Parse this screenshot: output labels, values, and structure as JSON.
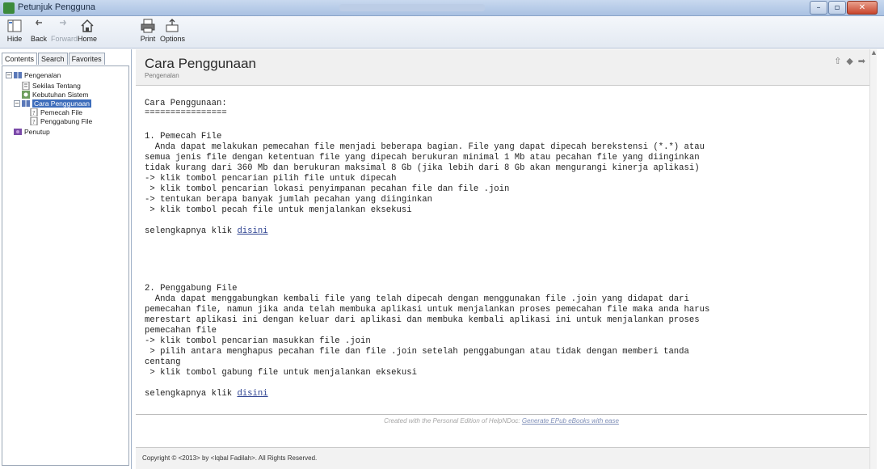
{
  "window": {
    "title": "Petunjuk Pengguna",
    "controls": {
      "minimize": "–",
      "maximize": "▫",
      "close": "✕"
    }
  },
  "toolbar": {
    "hide": "Hide",
    "back": "Back",
    "forward": "Forward",
    "home": "Home",
    "print": "Print",
    "options": "Options"
  },
  "nav_tabs": {
    "contents": "Contents",
    "search": "Search",
    "favorites": "Favorites"
  },
  "tree": [
    {
      "label": "Pengenalan",
      "expander": "−"
    },
    {
      "label": "Sekilas Tentang",
      "expander": ""
    },
    {
      "label": "Kebutuhan Sistem",
      "expander": ""
    },
    {
      "label": "Cara Penggunaan",
      "expander": "−"
    },
    {
      "label": "Pemecah File",
      "expander": ""
    },
    {
      "label": "Penggabung File",
      "expander": ""
    },
    {
      "label": "Penutup",
      "expander": ""
    }
  ],
  "topic": {
    "title": "Cara Penggunaan",
    "subtitle": "Pengenalan",
    "nav": {
      "up": "⇧",
      "prev": "◆",
      "next": "➡"
    }
  },
  "content": {
    "heading": "Cara Penggunaan:",
    "heading_rule": "================",
    "section1_title": "1. Pemecah File",
    "section1_lines": [
      "  Anda dapat melakukan pemecahan file menjadi beberapa bagian. File yang dapat dipecah berekstensi (*.*) atau",
      "semua jenis file dengan ketentuan file yang dipecah berukuran minimal 1 Mb atau pecahan file yang diinginkan",
      "tidak kurang dari 360 Mb dan berukuran maksimal 8 Gb (jika lebih dari 8 Gb akan mengurangi kinerja aplikasi)",
      "-> klik tombol pencarian pilih file untuk dipecah",
      " > klik tombol pencarian lokasi penyimpanan pecahan file dan file .join",
      "-> tentukan berapa banyak jumlah pecahan yang diinginkan",
      " > klik tombol pecah file untuk menjalankan eksekusi"
    ],
    "more1_prefix": "selengkapnya klik ",
    "more1_link": "disini",
    "section2_title": "2. Penggabung File",
    "section2_lines": [
      "  Anda dapat menggabungkan kembali file yang telah dipecah dengan menggunakan file .join yang didapat dari",
      "pemecahan file, namun jika anda telah membuka aplikasi untuk menjalankan proses pemecahan file maka anda harus",
      "merestart aplikasi ini dengan keluar dari aplikasi dan membuka kembali aplikasi ini untuk menjalankan proses",
      "pemecahan file",
      "-> klik tombol pencarian masukkan file .join",
      " > pilih antara menghapus pecahan file dan file .join setelah penggabungan atau tidak dengan memberi tanda",
      "centang",
      " > klik tombol gabung file untuk menjalankan eksekusi"
    ],
    "more2_prefix": "selengkapnya klik ",
    "more2_link": "disini"
  },
  "footer": {
    "credit_text": "Created with the Personal Edition of HelpNDoc: ",
    "credit_link": "Generate EPub eBooks with ease",
    "copyright": "Copyright © <2013> by <Iqbal Fadilah>. All Rights Reserved."
  }
}
